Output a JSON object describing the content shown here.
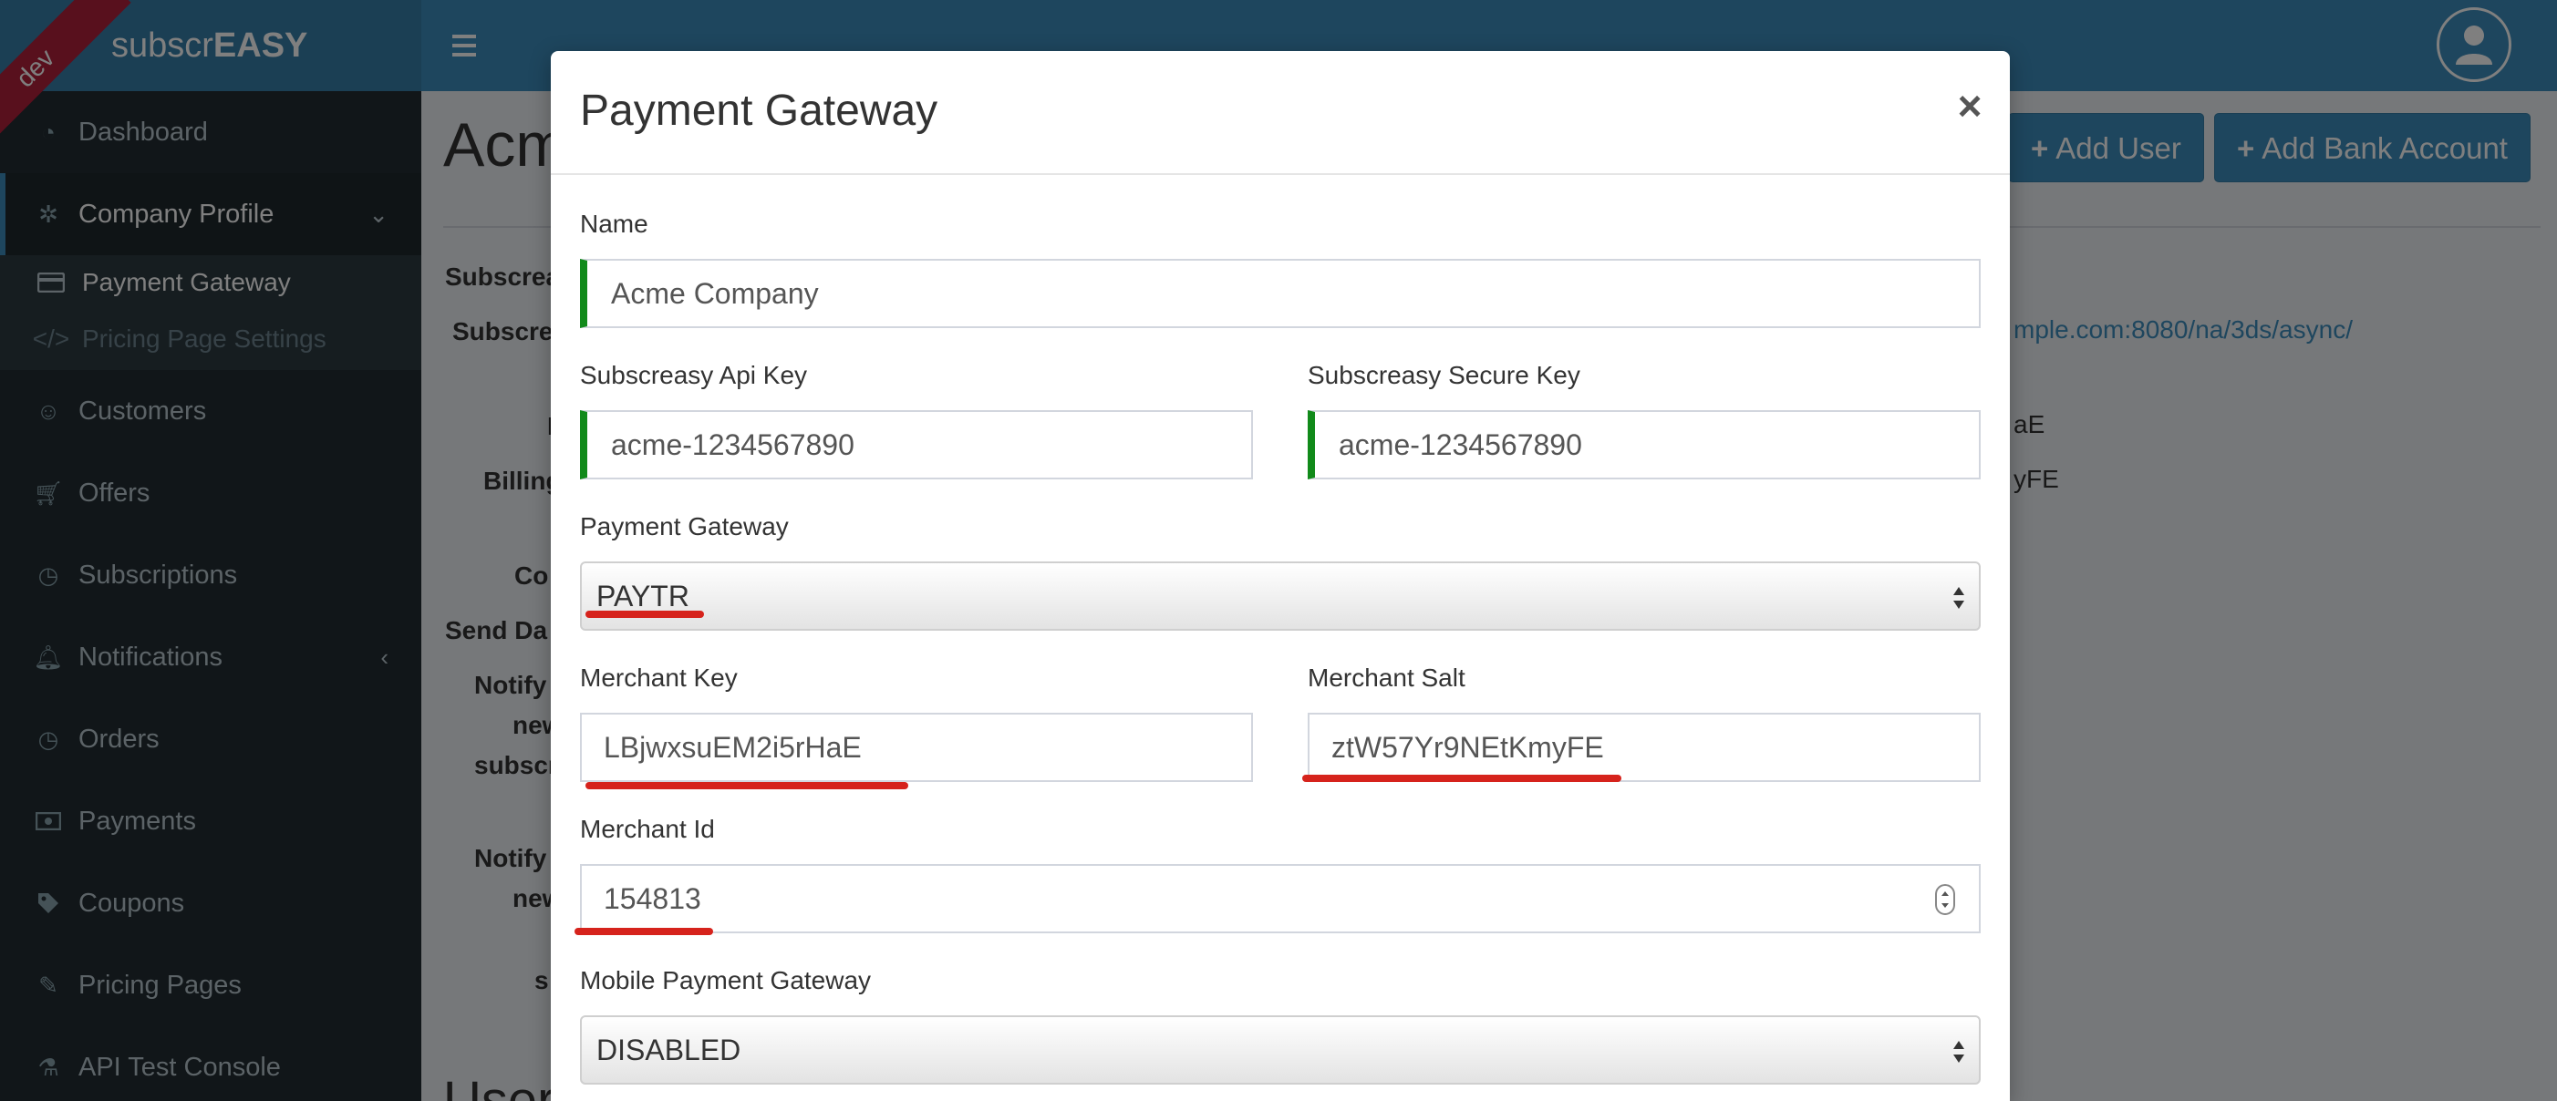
{
  "app": {
    "brand_light": "subscr",
    "brand_bold": "EASY",
    "env_ribbon": "dev"
  },
  "sidebar": {
    "items": [
      {
        "label": "Dashboard",
        "icon": "dashboard-icon"
      },
      {
        "label": "Company Profile",
        "icon": "gear-icon"
      },
      {
        "label": "Customers",
        "icon": "smile-icon"
      },
      {
        "label": "Offers",
        "icon": "cart-icon"
      },
      {
        "label": "Subscriptions",
        "icon": "clock-icon"
      },
      {
        "label": "Notifications",
        "icon": "bell-icon"
      },
      {
        "label": "Orders",
        "icon": "clock-icon"
      },
      {
        "label": "Payments",
        "icon": "money-icon"
      },
      {
        "label": "Coupons",
        "icon": "tag-icon"
      },
      {
        "label": "Pricing Pages",
        "icon": "magic-icon"
      },
      {
        "label": "API Test Console",
        "icon": "flask-icon"
      }
    ],
    "submenu": [
      {
        "label": "Payment Gateway",
        "icon": "credit-card-icon"
      },
      {
        "label": "Pricing Page Settings",
        "icon": "code-icon"
      }
    ]
  },
  "background": {
    "page_title": "Acme",
    "buttons": {
      "add_user": "Add User",
      "add_bank_account": "Add Bank Account",
      "plus": "+"
    },
    "labels": [
      "Subscrea",
      "Subscre",
      "I",
      "Billing",
      "Co",
      "Send Da",
      "Notify",
      "new",
      "subscr",
      "Notify",
      "new",
      "s"
    ],
    "values": {
      "callback_url": "mple.com:8080/na/3ds/async/",
      "merchant_key_tail": "aE",
      "merchant_salt_tail": "yFE"
    },
    "users_heading": "Users"
  },
  "modal": {
    "title": "Payment Gateway",
    "close": "×",
    "fields": {
      "name": {
        "label": "Name",
        "value": "Acme Company"
      },
      "api_key": {
        "label": "Subscreasy Api Key",
        "value": "acme-1234567890"
      },
      "secure_key": {
        "label": "Subscreasy Secure Key",
        "value": "acme-1234567890"
      },
      "payment_gateway": {
        "label": "Payment Gateway",
        "value": "PAYTR"
      },
      "merchant_key": {
        "label": "Merchant Key",
        "value": "LBjwxsuEM2i5rHaE"
      },
      "merchant_salt": {
        "label": "Merchant Salt",
        "value": "ztW57Yr9NEtKmyFE"
      },
      "merchant_id": {
        "label": "Merchant Id",
        "value": "154813"
      },
      "mobile_gateway": {
        "label": "Mobile Payment Gateway",
        "value": "DISABLED"
      }
    }
  },
  "colors": {
    "header": "#3c8dbc",
    "sidebar": "#222d32",
    "valid_border": "#118a1a",
    "annotation_red": "#d6231c"
  }
}
